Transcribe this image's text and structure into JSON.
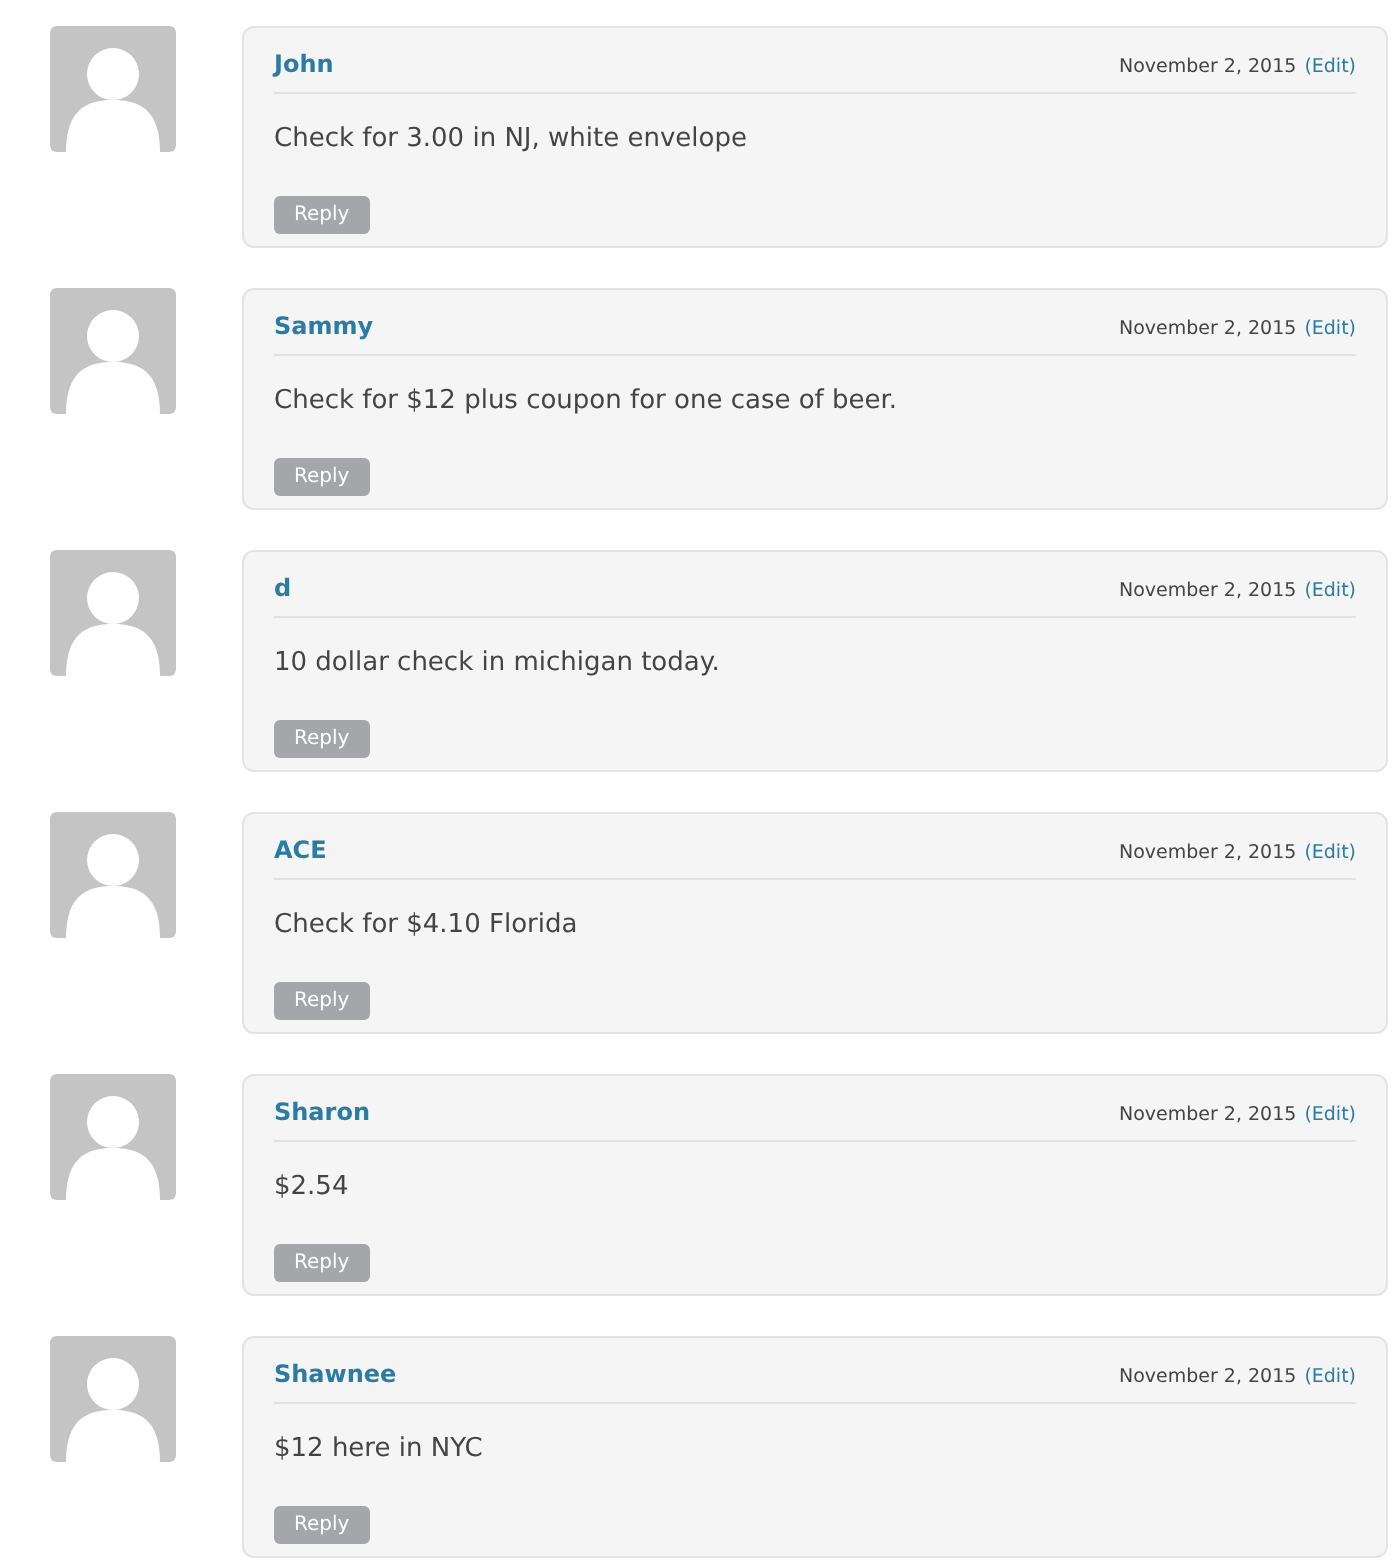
{
  "comments": [
    {
      "author": "John",
      "date": "November 2, 2015",
      "edit": "(Edit)",
      "text": "Check for 3.00 in NJ, white envelope",
      "reply": "Reply"
    },
    {
      "author": "Sammy",
      "date": "November 2, 2015",
      "edit": "(Edit)",
      "text": "Check for $12 plus coupon for one case of beer.",
      "reply": "Reply"
    },
    {
      "author": "d",
      "date": "November 2, 2015",
      "edit": "(Edit)",
      "text": "10 dollar check in michigan today.",
      "reply": "Reply"
    },
    {
      "author": "ACE",
      "date": "November 2, 2015",
      "edit": "(Edit)",
      "text": "Check for $4.10 Florida",
      "reply": "Reply"
    },
    {
      "author": "Sharon",
      "date": "November 2, 2015",
      "edit": "(Edit)",
      "text": "$2.54",
      "reply": "Reply"
    },
    {
      "author": "Shawnee",
      "date": "November 2, 2015",
      "edit": "(Edit)",
      "text": "$12 here in NYC",
      "reply": "Reply"
    }
  ]
}
